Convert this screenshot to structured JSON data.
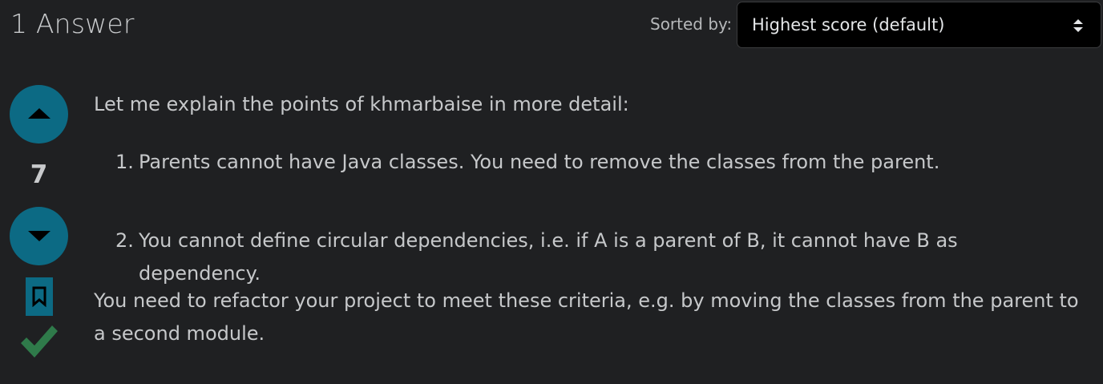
{
  "header": {
    "answer_count": "1 Answer",
    "sort_label": "Sorted by:",
    "sort_selected": "Highest score (default)"
  },
  "votes": {
    "score": "7",
    "accepted": true
  },
  "post": {
    "intro": "Let me explain the points of khmarbaise in more detail:",
    "items": [
      {
        "num": "1.",
        "text": "Parents cannot have Java classes. You need to remove the classes from the parent."
      },
      {
        "num": "2.",
        "text": "You cannot define circular dependencies, i.e. if A is a parent of B, it cannot have B as dependency."
      }
    ],
    "conclusion": "You need to refactor your project to meet these criteria, e.g. by moving the classes from the parent to a second module."
  },
  "colors": {
    "background": "#1f2022",
    "vote_button": "#0c6a84",
    "accepted_check": "#2f7a4a"
  },
  "icons": [
    "caret-up-icon",
    "caret-down-icon",
    "bookmark-icon",
    "checkmark-icon",
    "select-arrows-icon"
  ]
}
